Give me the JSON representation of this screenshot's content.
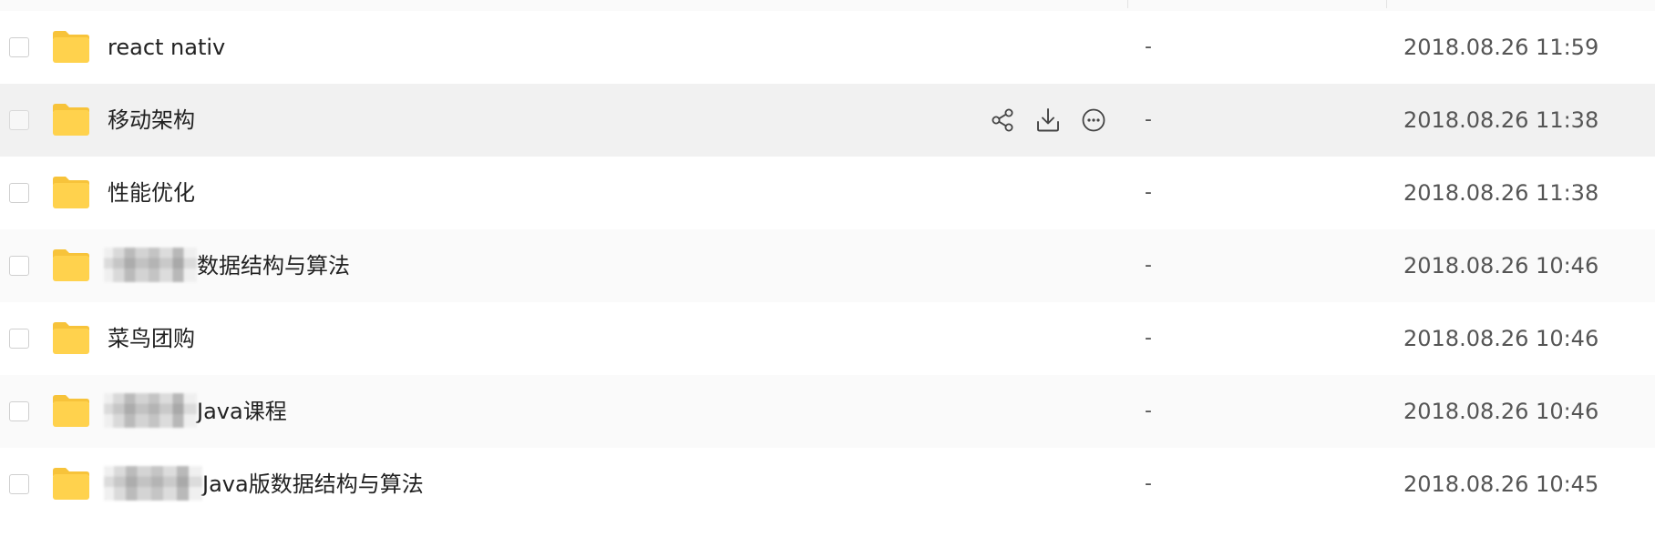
{
  "file_list": {
    "rows": [
      {
        "name_prefix": "",
        "name": "react nativ",
        "size": "-",
        "date": "2018.08.26 11:59"
      },
      {
        "name_prefix": "",
        "name": "移动架构",
        "size": "-",
        "date": "2018.08.26 11:38"
      },
      {
        "name_prefix": "",
        "name": "性能优化",
        "size": "-",
        "date": "2018.08.26 11:38"
      },
      {
        "name_prefix": "[obscured]",
        "name": "数据结构与算法",
        "size": "-",
        "date": "2018.08.26 10:46"
      },
      {
        "name_prefix": "",
        "name": "菜鸟团购",
        "size": "-",
        "date": "2018.08.26 10:46"
      },
      {
        "name_prefix": "[obscured]",
        "name": "Java课程",
        "size": "-",
        "date": "2018.08.26 10:46"
      },
      {
        "name_prefix": "[obscured]",
        "name": "Java版数据结构与算法",
        "size": "-",
        "date": "2018.08.26 10:45"
      }
    ],
    "hover_row_actions": {
      "share_icon": "share-icon",
      "download_icon": "download-icon",
      "more_icon": "more-options-icon"
    },
    "colors": {
      "folder": "#FFD24D",
      "folder_tab": "#F7C33A",
      "row_alt_bg": "#FAFAFA",
      "row_hover_bg": "#F1F1F1"
    }
  }
}
